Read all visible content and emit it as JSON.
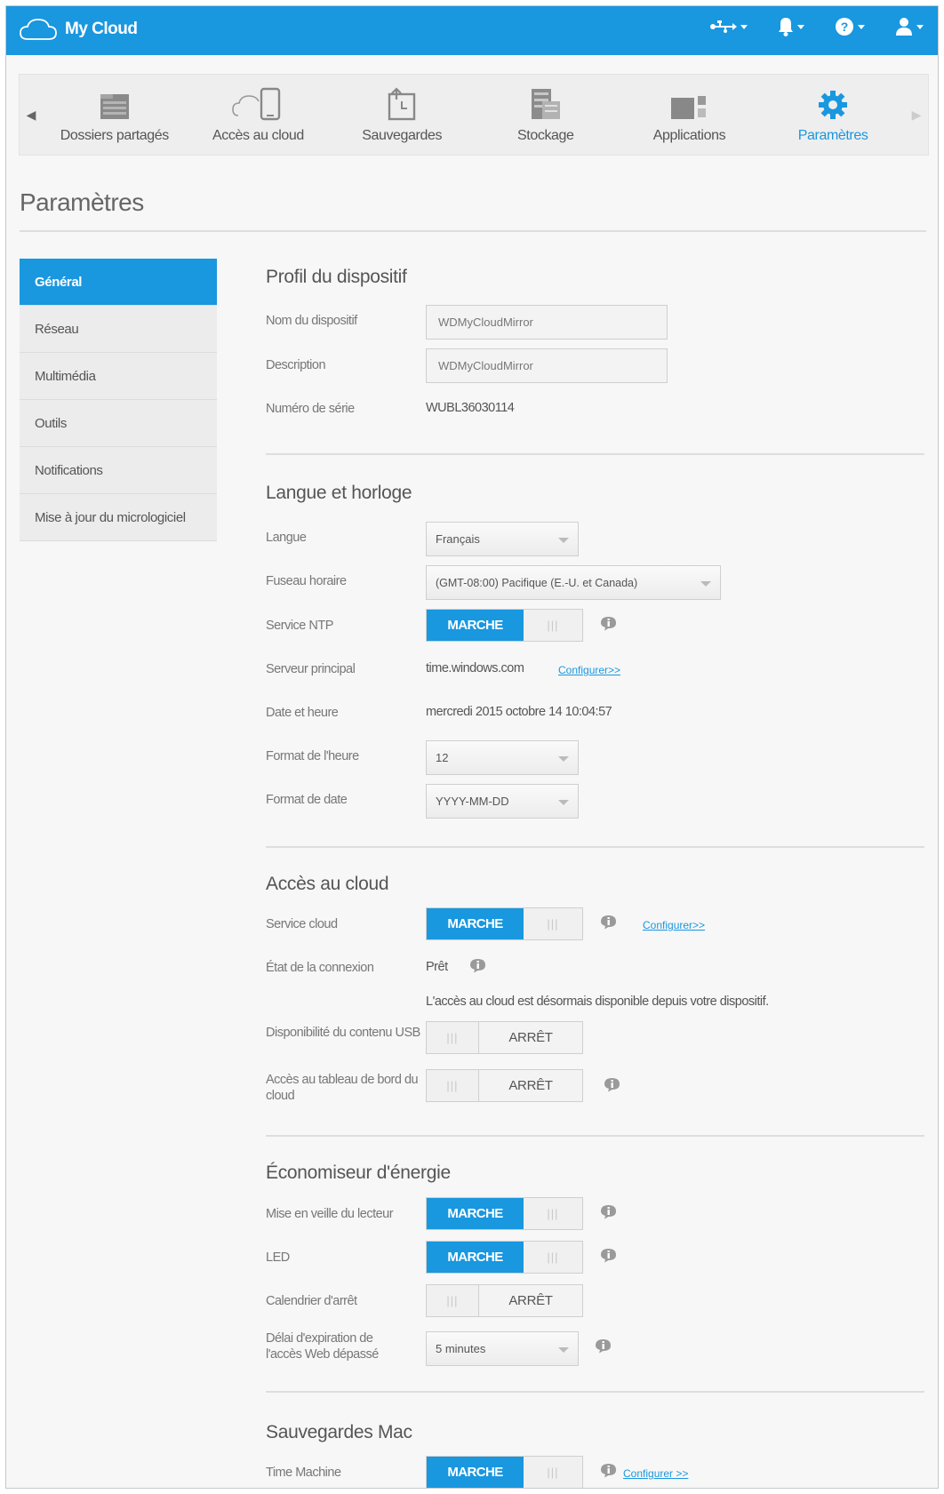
{
  "app": {
    "title": "My Cloud"
  },
  "topbar": {
    "icons": [
      "usb-icon",
      "bell-icon",
      "help-icon",
      "user-icon"
    ]
  },
  "nav": {
    "items": [
      {
        "label": "Dossiers partagés",
        "icon": "shared-folders-icon"
      },
      {
        "label": "Accès au cloud",
        "icon": "cloud-access-icon"
      },
      {
        "label": "Sauvegardes",
        "icon": "backups-icon"
      },
      {
        "label": "Stockage",
        "icon": "storage-icon"
      },
      {
        "label": "Applications",
        "icon": "apps-icon"
      },
      {
        "label": "Paramètres",
        "icon": "gear-icon",
        "active": true
      }
    ]
  },
  "page": {
    "title": "Paramètres"
  },
  "sidebar": {
    "items": [
      {
        "label": "Général",
        "active": true
      },
      {
        "label": "Réseau"
      },
      {
        "label": "Multimédia"
      },
      {
        "label": "Outils"
      },
      {
        "label": "Notifications"
      },
      {
        "label": "Mise à jour du micrologiciel"
      }
    ]
  },
  "profile": {
    "title": "Profil du dispositif",
    "name_label": "Nom du dispositif",
    "name_value": "WDMyCloudMirror",
    "desc_label": "Description",
    "desc_value": "WDMyCloudMirror",
    "serial_label": "Numéro de série",
    "serial_value": "WUBL36030114"
  },
  "clock": {
    "title": "Langue et horloge",
    "language_label": "Langue",
    "language_value": "Français",
    "timezone_label": "Fuseau horaire",
    "timezone_value": "(GMT-08:00) Pacifique (E.-U. et Canada)",
    "ntp_label": "Service NTP",
    "ntp_state": "MARCHE",
    "server_label": "Serveur principal",
    "server_value": "time.windows.com",
    "server_link": "Configurer>>",
    "datetime_label": "Date et heure",
    "datetime_value": "mercredi 2015 octobre 14 10:04:57",
    "timeformat_label": "Format de l'heure",
    "timeformat_value": "12",
    "dateformat_label": "Format de date",
    "dateformat_value": "YYYY-MM-DD"
  },
  "cloud": {
    "title": "Accès au cloud",
    "service_label": "Service cloud",
    "service_state": "MARCHE",
    "service_link": "Configurer>>",
    "connection_label": "État de la connexion",
    "connection_value": "Prêt",
    "availability_message": "L'accès au cloud est désormais disponible depuis votre dispositif.",
    "usb_label": "Disponibilité du contenu USB",
    "usb_state": "ARRÊT",
    "dashboard_label": "Accès au tableau de bord du cloud",
    "dashboard_state": "ARRÊT"
  },
  "energy": {
    "title": "Économiseur d'énergie",
    "sleep_label": "Mise en veille du lecteur",
    "sleep_state": "MARCHE",
    "led_label": "LED",
    "led_state": "MARCHE",
    "schedule_label": "Calendrier d'arrêt",
    "schedule_state": "ARRÊT",
    "timeout_label": "Délai d'expiration de l'accès Web dépassé",
    "timeout_value": "5 minutes"
  },
  "mac": {
    "title": "Sauvegardes Mac",
    "tm_label": "Time Machine",
    "tm_state": "MARCHE",
    "tm_link": "Configurer >>"
  },
  "colors": {
    "accent": "#1997df",
    "background": "#f7f7f7",
    "sidebar": "#ececec"
  }
}
